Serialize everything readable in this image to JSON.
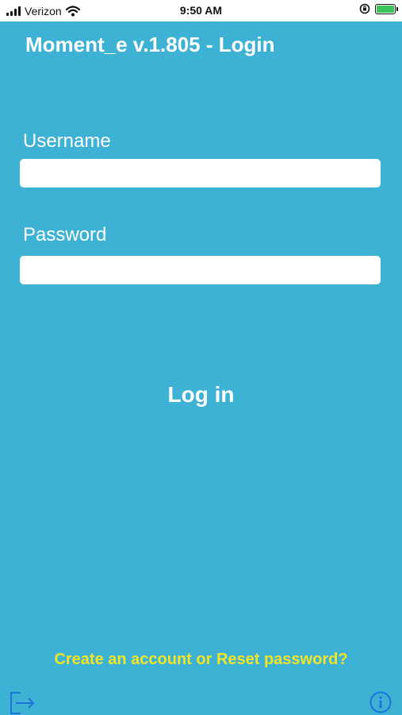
{
  "status_bar": {
    "carrier": "Verizon",
    "time": "9:50 AM"
  },
  "screen": {
    "title": "Moment_e v.1.805 - Login",
    "background_color": "#3db2d4"
  },
  "form": {
    "username_label": "Username",
    "username_value": "",
    "password_label": "Password",
    "password_value": "",
    "login_label": "Log in"
  },
  "footer": {
    "account_link": "Create an account or Reset password?",
    "link_color": "#f2e427",
    "left_icon": "logout-icon",
    "right_icon": "info-icon"
  }
}
